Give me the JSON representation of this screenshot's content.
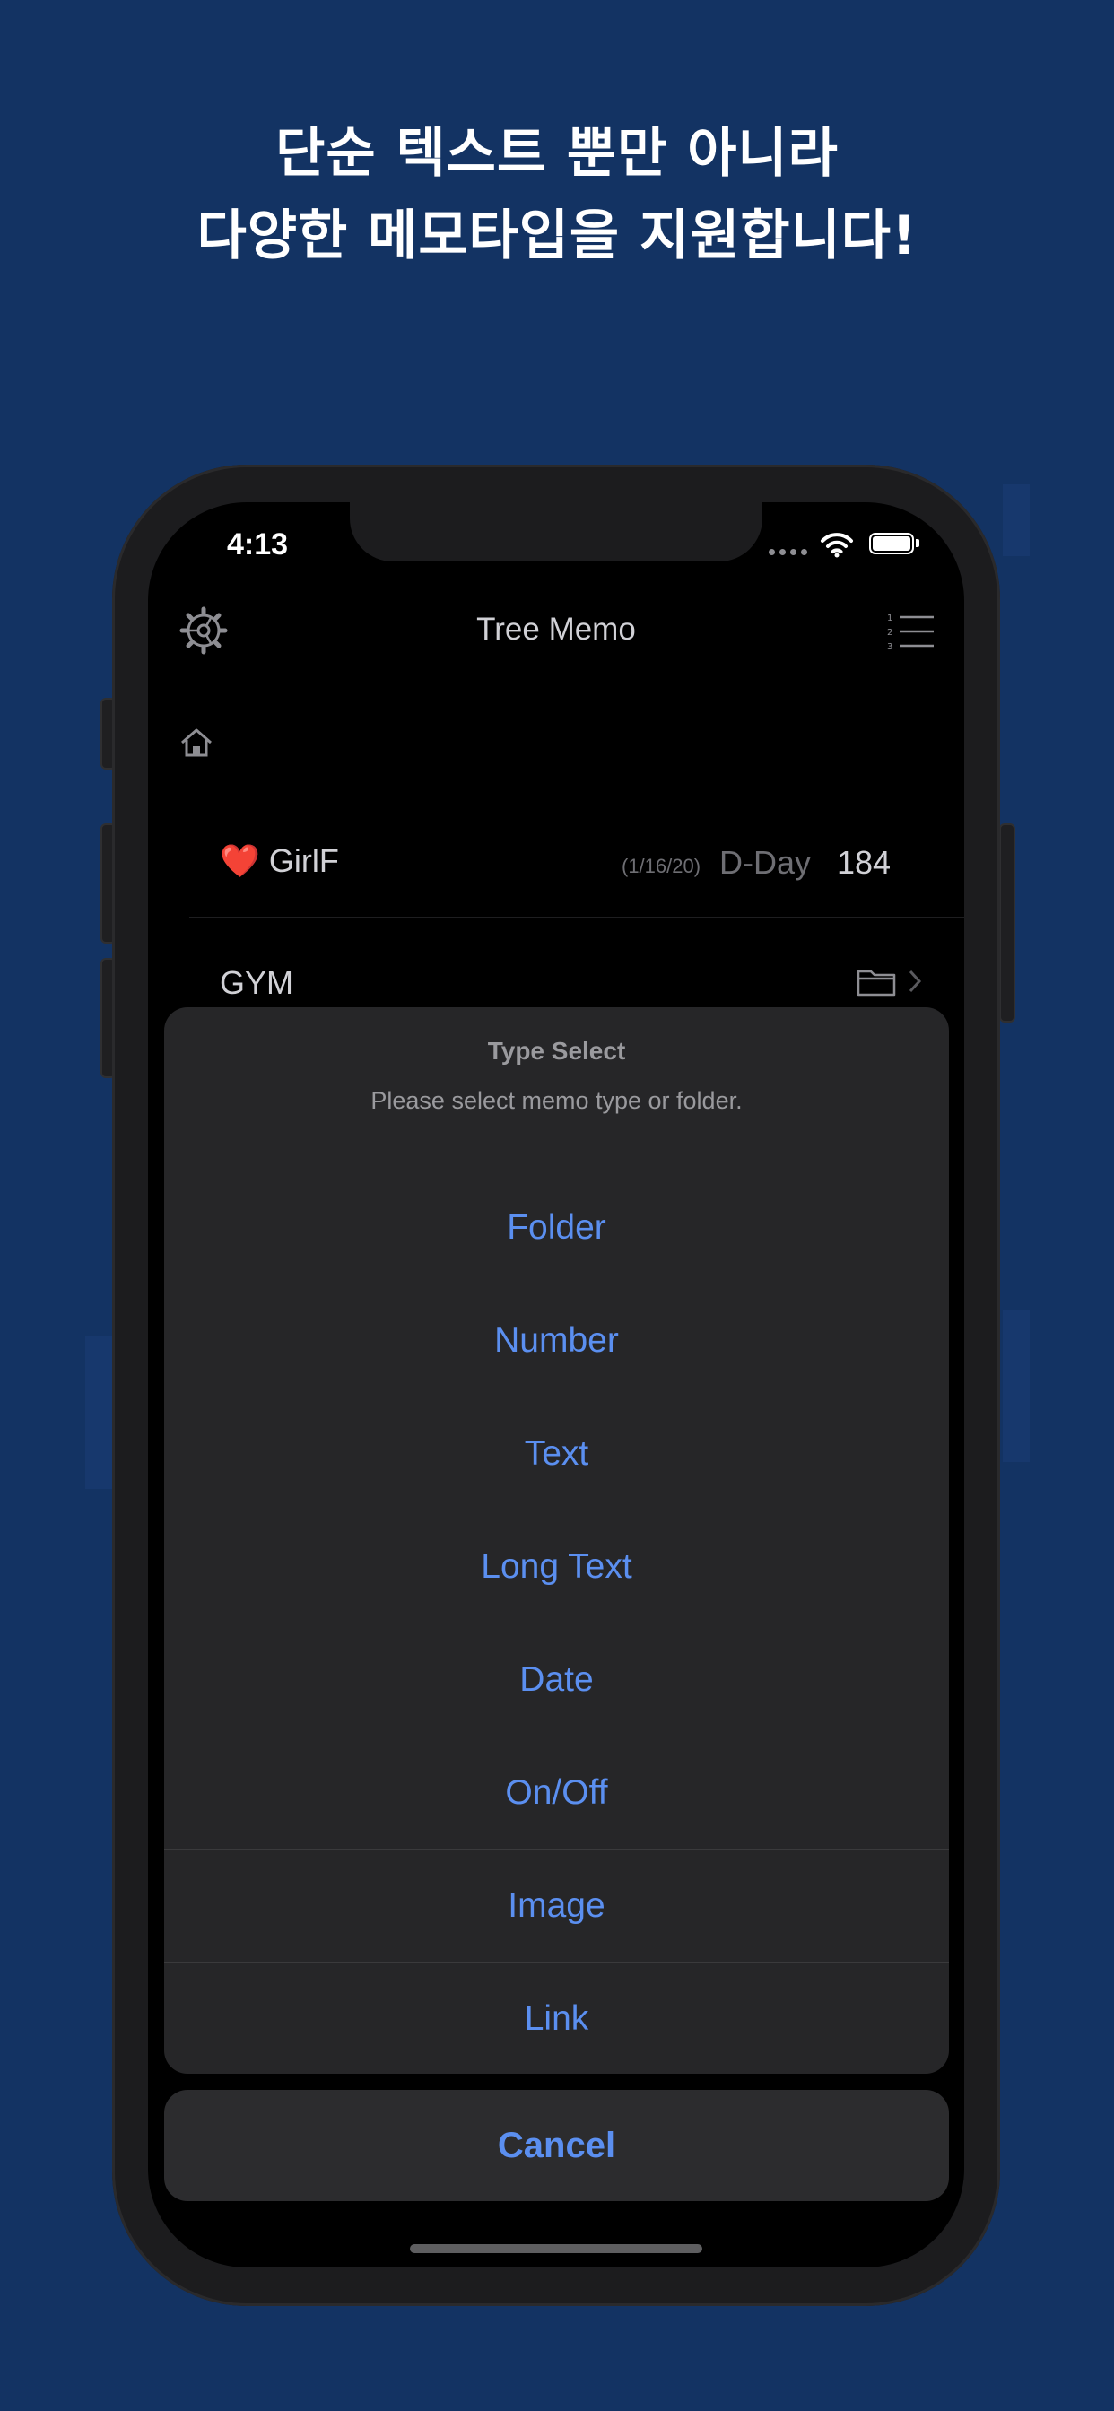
{
  "headline": {
    "line1": "단순 텍스트 뿐만 아니라",
    "line2": "다양한 메모타입을 지원합니다!"
  },
  "status_bar": {
    "time": "4:13"
  },
  "nav": {
    "title": "Tree Memo",
    "left_icon": "gear-icon",
    "right_icon": "numbered-list-icon"
  },
  "breadcrumb": {
    "icon": "home-icon"
  },
  "rows": [
    {
      "emoji": "❤️",
      "title": "GirlF",
      "dday_date": "(1/16/20)",
      "dday_label": "D-Day",
      "dday_count": "184"
    },
    {
      "title": "GYM",
      "icon": "folder-icon",
      "accessory": "chevron-right-icon"
    }
  ],
  "sheet": {
    "title": "Type Select",
    "message": "Please select memo type or folder.",
    "options": [
      "Folder",
      "Number",
      "Text",
      "Long Text",
      "Date",
      "On/Off",
      "Image",
      "Link"
    ],
    "cancel": "Cancel"
  },
  "colors": {
    "page_background": "#133363",
    "accent": "#5b8ff0",
    "sheet_background": "#262628"
  }
}
